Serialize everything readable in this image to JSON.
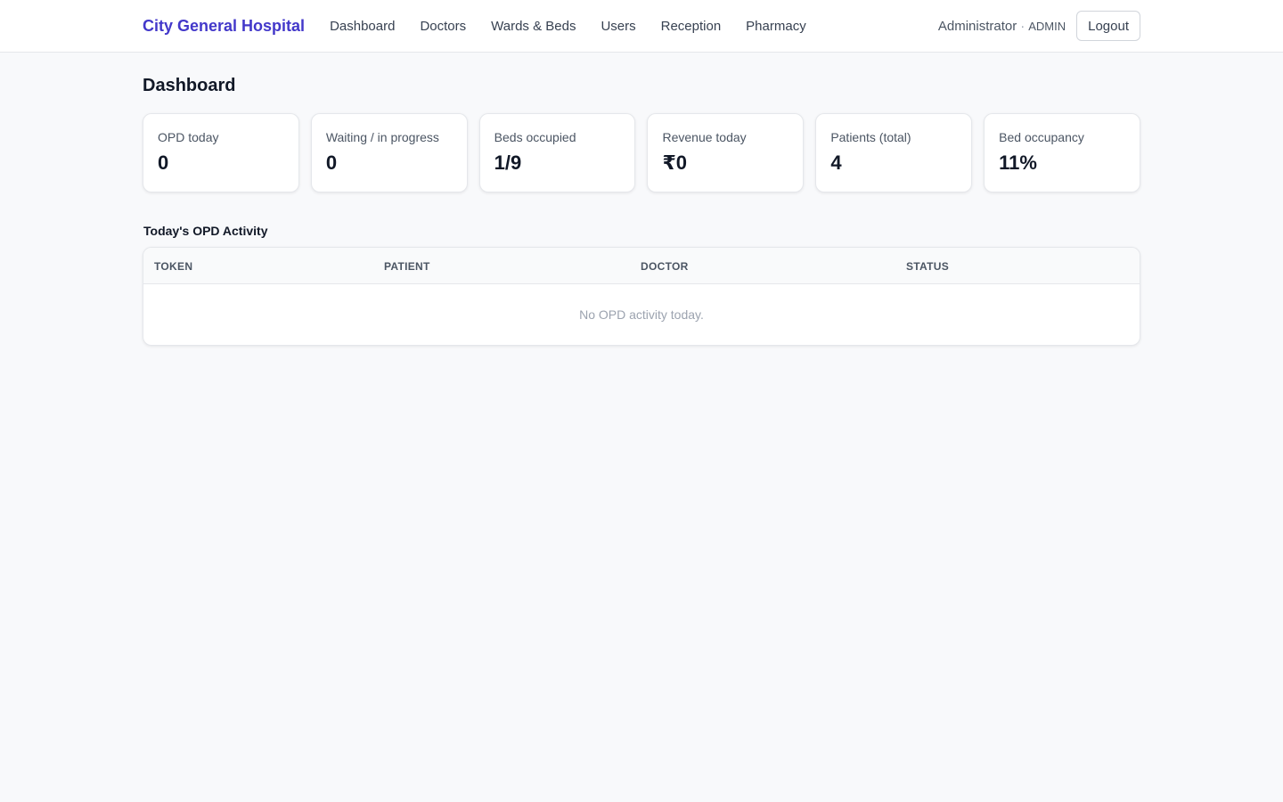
{
  "header": {
    "brand": "City General Hospital",
    "nav": [
      {
        "label": "Dashboard"
      },
      {
        "label": "Doctors"
      },
      {
        "label": "Wards & Beds"
      },
      {
        "label": "Users"
      },
      {
        "label": "Reception"
      },
      {
        "label": "Pharmacy"
      }
    ],
    "user_name": "Administrator",
    "separator": "·",
    "user_role": "ADMIN",
    "logout_label": "Logout"
  },
  "page": {
    "title": "Dashboard"
  },
  "stats": [
    {
      "label": "OPD today",
      "value": "0"
    },
    {
      "label": "Waiting / in progress",
      "value": "0"
    },
    {
      "label": "Beds occupied",
      "value": "1/9"
    },
    {
      "label": "Revenue today",
      "value": "₹0"
    },
    {
      "label": "Patients (total)",
      "value": "4"
    },
    {
      "label": "Bed occupancy",
      "value": "11%"
    }
  ],
  "opd": {
    "title": "Today's OPD Activity",
    "columns": [
      "Token",
      "Patient",
      "Doctor",
      "Status"
    ],
    "empty_message": "No OPD activity today."
  },
  "colors": {
    "brand": "#4338ca",
    "background": "#f8f9fb",
    "card": "#ffffff",
    "border": "#e5e7eb"
  }
}
